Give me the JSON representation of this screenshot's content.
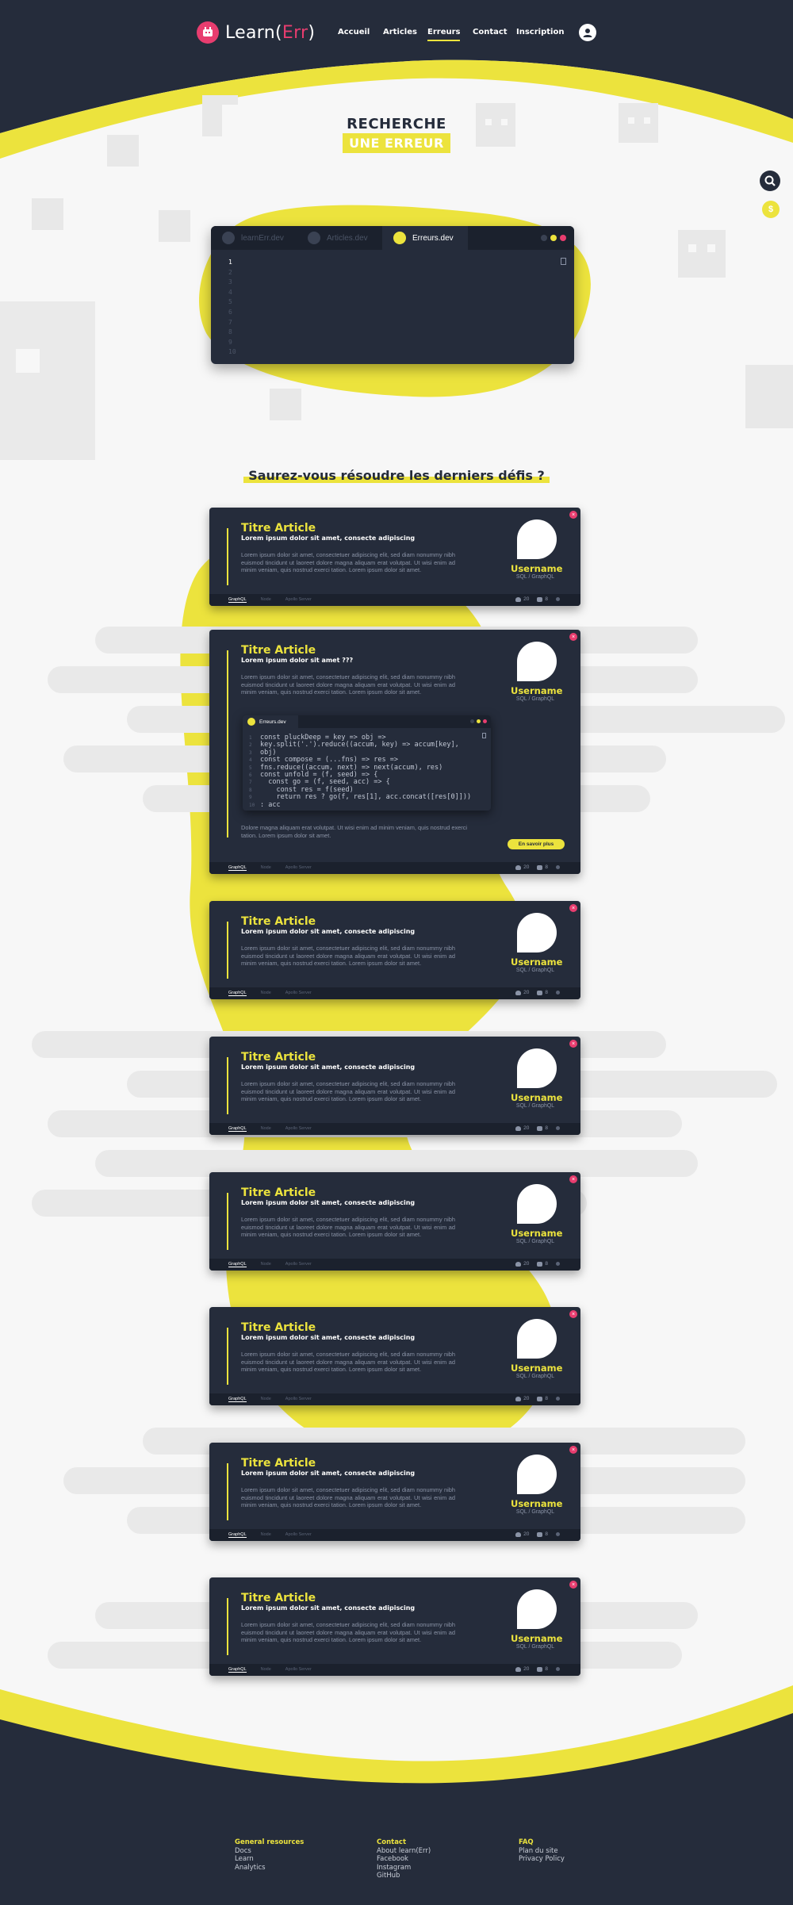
{
  "brand": {
    "name_main": "Learn(",
    "name_accent": "Err",
    "name_end": ")"
  },
  "nav": {
    "items": [
      {
        "label": "Accueil"
      },
      {
        "label": "Articles"
      },
      {
        "label": "Erreurs"
      },
      {
        "label": "Contact"
      },
      {
        "label": "Inscription"
      }
    ],
    "active": "Erreurs"
  },
  "hero": {
    "line1": "RECHERCHE",
    "line2": "UNE ERREUR"
  },
  "editor": {
    "tabs": [
      "learnErr.dev",
      "Articles.dev",
      "Erreurs.dev"
    ],
    "line_numbers": [
      "1",
      "2",
      "3",
      "4",
      "5",
      "6",
      "7",
      "8",
      "9",
      "10"
    ]
  },
  "section_title": "Saurez-vous résoudre les derniers défis ?",
  "cards": [
    {
      "title": "Titre Article",
      "subtitle": "Lorem ipsum dolor sit amet, consecte adipiscing",
      "body": "Lorem ipsum dolor sit amet, consectetuer adipiscing elit, sed diam nonummy nibh euismod tincidunt ut laoreet dolore magna aliquam erat volutpat. Ut wisi enim ad minim veniam, quis nostrud exerci tation. Lorem ipsum dolor sit amet.",
      "username": "Username",
      "tags": "SQL / GraphQL",
      "footer_tags": [
        "GraphQL",
        "Node",
        "Apollo Server"
      ],
      "likes": "20",
      "comments": "8"
    },
    {
      "title": "Titre Article",
      "subtitle": "Lorem ipsum dolor sit amet ???",
      "body": "Lorem ipsum dolor sit amet, consectetuer adipiscing elit, sed diam nonummy nibh euismod tincidunt ut laoreet dolore magna aliquam erat volutpat. Ut wisi enim ad minim veniam, quis nostrud exerci tation. Lorem ipsum dolor sit amet.",
      "username": "Username",
      "tags": "SQL / GraphQL",
      "footer_tags": [
        "GraphQL",
        "Node",
        "Apollo Server"
      ],
      "likes": "20",
      "comments": "8",
      "snippet_tab": "Erreurs.dev",
      "code": [
        "const pluckDeep = key => obj =>",
        "key.split('.').reduce((accum, key) => accum[key],",
        "obj)",
        "const compose = (...fns) => res =>",
        "fns.reduce((accum, next) => next(accum), res)",
        "const unfold = (f, seed) => {",
        "  const go = (f, seed, acc) => {",
        "    const res = f(seed)",
        "    return res ? go(f, res[1], acc.concat([res[0]]))",
        ": acc"
      ],
      "code_line_numbers": [
        "1",
        "2",
        "",
        "3",
        "4",
        "5",
        "6",
        "7",
        "8",
        "9",
        "10"
      ],
      "after": "Dolore magna aliquam erat volutpat. Ut wisi enim ad minim veniam, quis nostrud exerci tation. Lorem ipsum dolor sit amet.",
      "more": "En savoir plus"
    },
    {
      "title": "Titre Article",
      "subtitle": "Lorem ipsum dolor sit amet, consecte adipiscing",
      "body": "Lorem ipsum dolor sit amet, consectetuer adipiscing elit, sed diam nonummy nibh euismod tincidunt ut laoreet dolore magna aliquam erat volutpat. Ut wisi enim ad minim veniam, quis nostrud exerci tation. Lorem ipsum dolor sit amet.",
      "username": "Username",
      "tags": "SQL / GraphQL",
      "footer_tags": [
        "GraphQL",
        "Node",
        "Apollo Server"
      ],
      "likes": "20",
      "comments": "8"
    },
    {
      "title": "Titre Article",
      "subtitle": "Lorem ipsum dolor sit amet, consecte adipiscing",
      "body": "Lorem ipsum dolor sit amet, consectetuer adipiscing elit, sed diam nonummy nibh euismod tincidunt ut laoreet dolore magna aliquam erat volutpat. Ut wisi enim ad minim veniam, quis nostrud exerci tation. Lorem ipsum dolor sit amet.",
      "username": "Username",
      "tags": "SQL / GraphQL",
      "footer_tags": [
        "GraphQL",
        "Node",
        "Apollo Server"
      ],
      "likes": "20",
      "comments": "8"
    },
    {
      "title": "Titre Article",
      "subtitle": "Lorem ipsum dolor sit amet, consecte adipiscing",
      "body": "Lorem ipsum dolor sit amet, consectetuer adipiscing elit, sed diam nonummy nibh euismod tincidunt ut laoreet dolore magna aliquam erat volutpat. Ut wisi enim ad minim veniam, quis nostrud exerci tation. Lorem ipsum dolor sit amet.",
      "username": "Username",
      "tags": "SQL / GraphQL",
      "footer_tags": [
        "GraphQL",
        "Node",
        "Apollo Server"
      ],
      "likes": "20",
      "comments": "8"
    },
    {
      "title": "Titre Article",
      "subtitle": "Lorem ipsum dolor sit amet, consecte adipiscing",
      "body": "Lorem ipsum dolor sit amet, consectetuer adipiscing elit, sed diam nonummy nibh euismod tincidunt ut laoreet dolore magna aliquam erat volutpat. Ut wisi enim ad minim veniam, quis nostrud exerci tation. Lorem ipsum dolor sit amet.",
      "username": "Username",
      "tags": "SQL / GraphQL",
      "footer_tags": [
        "GraphQL",
        "Node",
        "Apollo Server"
      ],
      "likes": "20",
      "comments": "8"
    },
    {
      "title": "Titre Article",
      "subtitle": "Lorem ipsum dolor sit amet, consecte adipiscing",
      "body": "Lorem ipsum dolor sit amet, consectetuer adipiscing elit, sed diam nonummy nibh euismod tincidunt ut laoreet dolore magna aliquam erat volutpat. Ut wisi enim ad minim veniam, quis nostrud exerci tation. Lorem ipsum dolor sit amet.",
      "username": "Username",
      "tags": "SQL / GraphQL",
      "footer_tags": [
        "GraphQL",
        "Node",
        "Apollo Server"
      ],
      "likes": "20",
      "comments": "8"
    },
    {
      "title": "Titre Article",
      "subtitle": "Lorem ipsum dolor sit amet, consecte adipiscing",
      "body": "Lorem ipsum dolor sit amet, consectetuer adipiscing elit, sed diam nonummy nibh euismod tincidunt ut laoreet dolore magna aliquam erat volutpat. Ut wisi enim ad minim veniam, quis nostrud exerci tation. Lorem ipsum dolor sit amet.",
      "username": "Username",
      "tags": "SQL / GraphQL",
      "footer_tags": [
        "GraphQL",
        "Node",
        "Apollo Server"
      ],
      "likes": "20",
      "comments": "8"
    }
  ],
  "footer": {
    "columns": [
      {
        "heading": "General resources",
        "links": [
          "Docs",
          "Learn",
          "Analytics"
        ]
      },
      {
        "heading": "Contact",
        "links": [
          "About learn(Err)",
          "Facebook",
          "Instagram",
          "GitHub"
        ]
      },
      {
        "heading": "FAQ",
        "links": [
          "Plan du site",
          "Privacy Policy"
        ]
      }
    ]
  },
  "colors": {
    "navy": "#252c3b",
    "yellow": "#ece33d",
    "pink": "#e83d6f",
    "background": "#f7f7f7"
  },
  "icons": [
    "logo-icon",
    "user-icon",
    "search-icon",
    "coin-icon",
    "close-icon",
    "copy-icon",
    "heart-icon",
    "comment-icon"
  ]
}
